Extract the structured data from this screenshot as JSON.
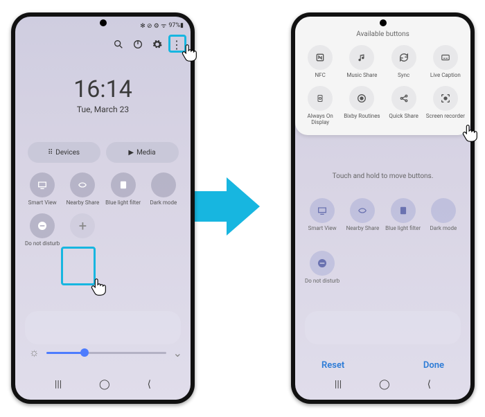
{
  "status": {
    "icons": "✻ ⊘ ⚙ ᯤ",
    "battery": "97%▮"
  },
  "topicons": {
    "search": "search-icon",
    "power": "power-icon",
    "settings": "gear-icon",
    "more": "more-vert-icon"
  },
  "clock": {
    "time": "16:14",
    "date": "Tue, March 23"
  },
  "pills": {
    "devices": "Devices",
    "media": "Media"
  },
  "tiles_row1": [
    {
      "label": "Smart View",
      "icon": "smartview-icon"
    },
    {
      "label": "Nearby Share",
      "icon": "nearby-share-icon"
    },
    {
      "label": "Blue light filter",
      "icon": "blue-light-icon"
    },
    {
      "label": "Dark mode",
      "icon": "dark-mode-icon"
    }
  ],
  "tiles_row2": [
    {
      "label": "Do not disturb",
      "icon": "dnd-icon"
    },
    {
      "label": "",
      "icon": "add-icon"
    }
  ],
  "slider": {
    "brightness_pct": 32
  },
  "nav": {
    "recents": "|||",
    "home": "◯",
    "back": "⟨"
  },
  "panel": {
    "title": "Available buttons",
    "items": [
      {
        "label": "NFC",
        "icon": "nfc-icon"
      },
      {
        "label": "Music Share",
        "icon": "music-share-icon"
      },
      {
        "label": "Sync",
        "icon": "sync-icon"
      },
      {
        "label": "Live Caption",
        "icon": "live-caption-icon"
      },
      {
        "label": "Always On Display",
        "icon": "aod-icon"
      },
      {
        "label": "Bixby Routines",
        "icon": "bixby-routines-icon"
      },
      {
        "label": "Quick Share",
        "icon": "quick-share-icon"
      },
      {
        "label": "Screen recorder",
        "icon": "screen-recorder-icon"
      }
    ]
  },
  "hint": "Touch and hold to move buttons.",
  "footer": {
    "reset": "Reset",
    "done": "Done"
  },
  "accent": "#17b6e0"
}
